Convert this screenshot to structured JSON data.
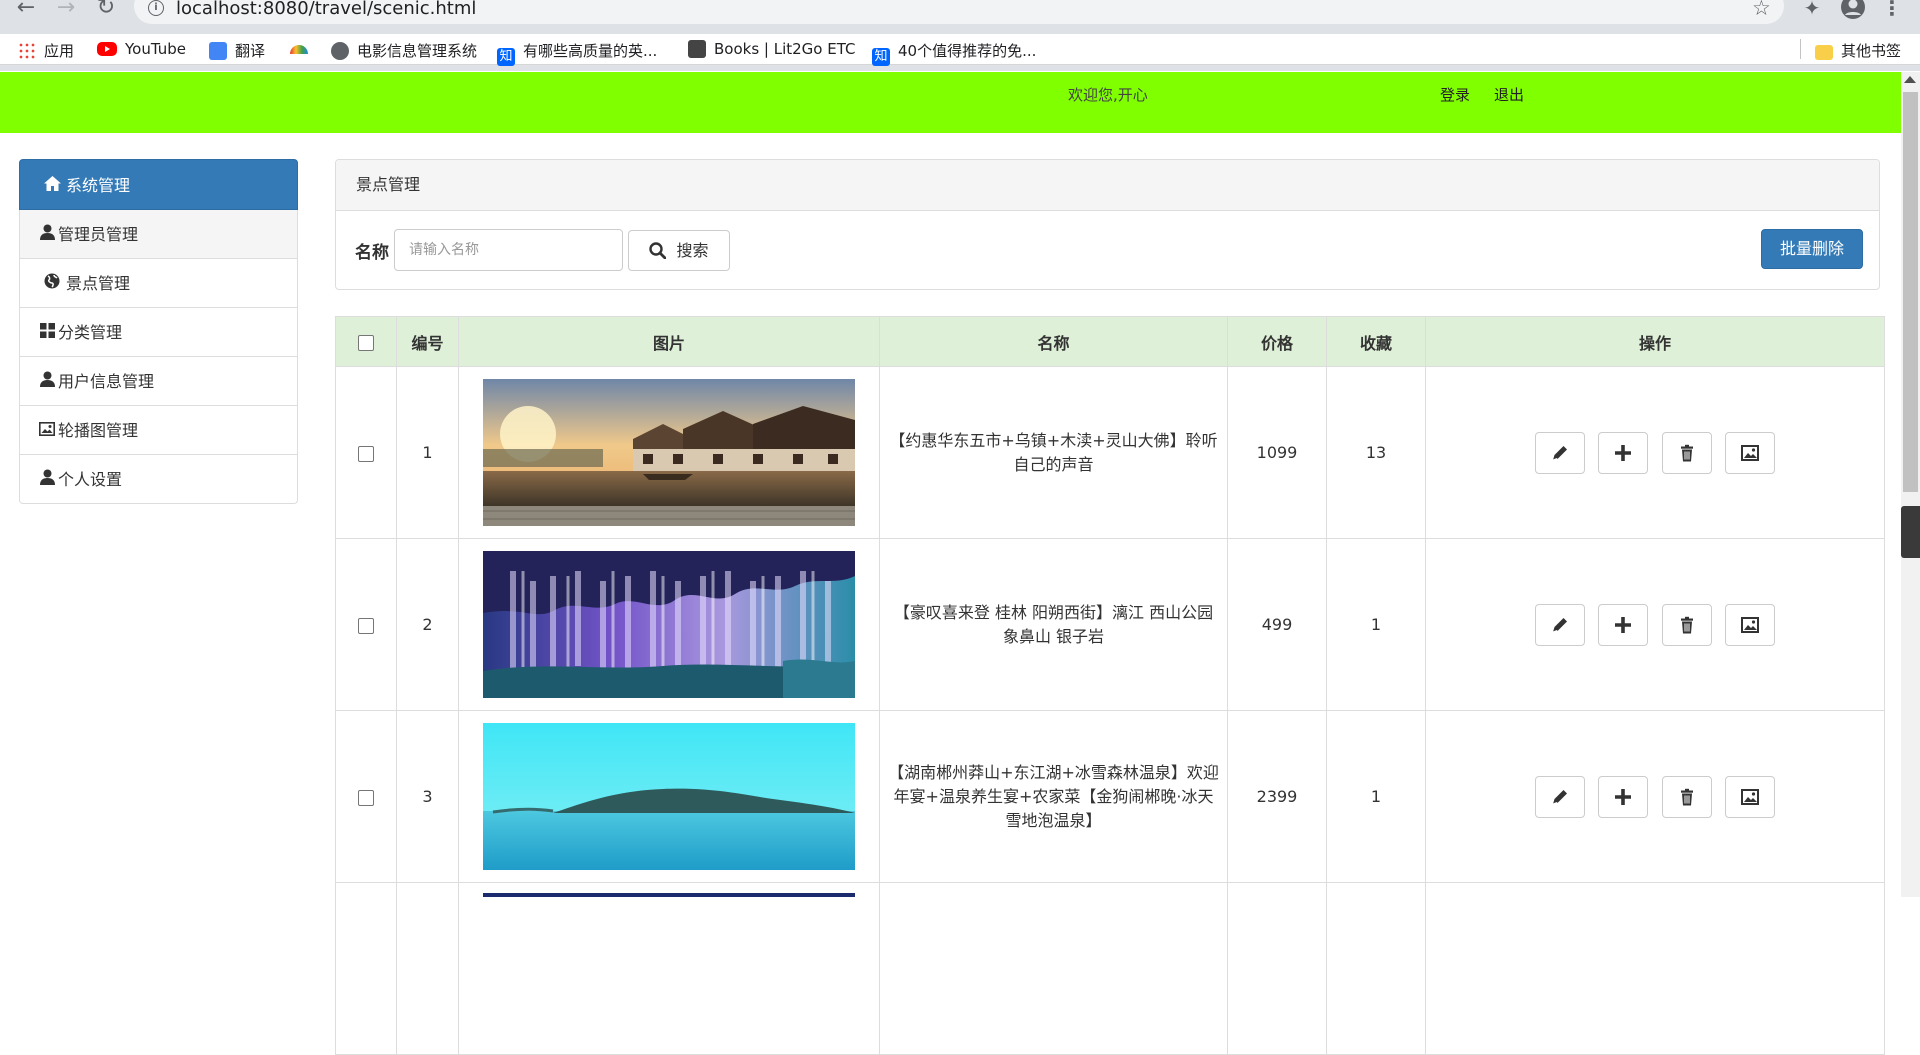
{
  "browser": {
    "url": "localhost:8080/travel/scenic.html",
    "bookmarks": [
      {
        "label": "应用",
        "icon": "apps-grid-icon"
      },
      {
        "label": "YouTube",
        "icon": "youtube-icon"
      },
      {
        "label": "翻译",
        "icon": "translate-icon"
      },
      {
        "label": "",
        "icon": "rainbow-icon"
      },
      {
        "label": "电影信息管理系统",
        "icon": "globe-icon"
      },
      {
        "label": "有哪些高质量的英...",
        "icon": "zhihu-icon"
      },
      {
        "label": "Books | Lit2Go ETC",
        "icon": "lit2go-icon"
      },
      {
        "label": "40个值得推荐的免...",
        "icon": "zhihu-icon"
      }
    ],
    "other_bookmarks": "其他书签",
    "zhihu_glyph": "知"
  },
  "header": {
    "welcome": "欢迎您,开心",
    "login": "登录",
    "logout": "退出",
    "color": "#80ff00"
  },
  "sidebar": {
    "items": [
      {
        "label": "系统管理",
        "icon": "home-icon",
        "active": true
      },
      {
        "label": "管理员管理",
        "icon": "user-icon"
      },
      {
        "label": "景点管理",
        "icon": "globe-icon"
      },
      {
        "label": "分类管理",
        "icon": "grid-icon"
      },
      {
        "label": "用户信息管理",
        "icon": "user-icon"
      },
      {
        "label": "轮播图管理",
        "icon": "picture-icon"
      },
      {
        "label": "个人设置",
        "icon": "user-icon"
      }
    ],
    "accent": "#337ab7"
  },
  "panel": {
    "title": "景点管理",
    "search_label": "名称",
    "search_placeholder": "请输入名称",
    "search_button": "搜索",
    "batch_delete": "批量删除"
  },
  "table": {
    "headers": [
      "编号",
      "图片",
      "名称",
      "价格",
      "收藏",
      "操作"
    ],
    "rows": [
      {
        "id": "1",
        "name": "【约惠华东五市+乌镇+木渎+灵山大佛】聆听自己的声音",
        "price": "1099",
        "fav": "13",
        "image": "water-town-photo"
      },
      {
        "id": "2",
        "name": "【豪叹喜来登 桂林 阳朔西街】漓江 西山公园 象鼻山 银子岩",
        "price": "499",
        "fav": "1",
        "image": "karst-cave-photo"
      },
      {
        "id": "3",
        "name": "【湖南郴州莽山+东江湖+冰雪森林温泉】欢迎年宴+温泉养生宴+农家菜【金狗闹郴晚·冰天雪地泡温泉】",
        "price": "2399",
        "fav": "1",
        "image": "lake-island-photo"
      }
    ],
    "actions": [
      "edit-icon",
      "add-icon",
      "delete-icon",
      "image-icon"
    ],
    "header_bg": "#dff0d8"
  }
}
